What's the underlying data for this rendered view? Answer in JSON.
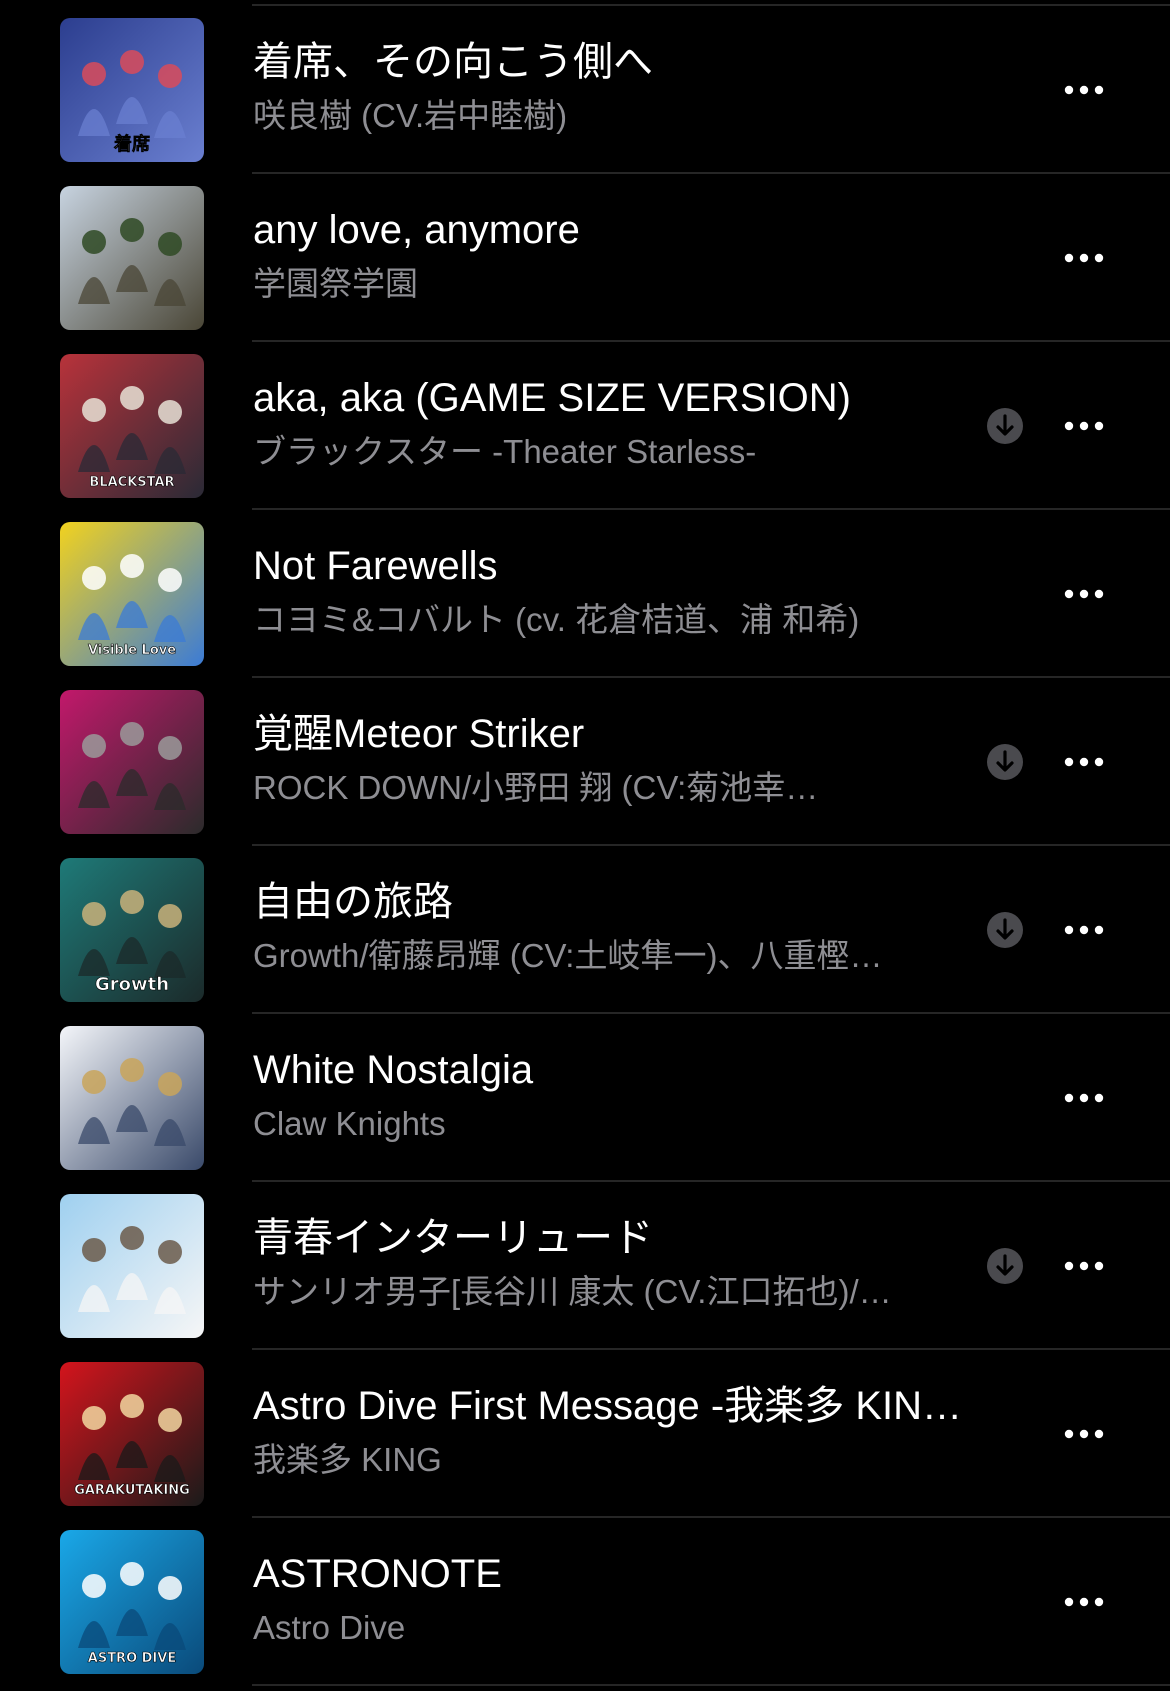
{
  "tracks": [
    {
      "title": "着席、その向こう側へ",
      "artist": "咲良樹 (CV.岩中睦樹)",
      "downloadable": false,
      "artwork": {
        "bg": "#2c3e8f",
        "bg2": "#6a7fd0",
        "accent": "#d94b5a",
        "text": "着席"
      }
    },
    {
      "title": "any love, anymore",
      "artist": "学園祭学園",
      "downloadable": false,
      "artwork": {
        "bg": "#c7d3e0",
        "bg2": "#4a4636",
        "accent": "#2f4a24",
        "text": ""
      }
    },
    {
      "title": "aka, aka (GAME SIZE VERSION)",
      "artist": "ブラックスター -Theater Starless-",
      "downloadable": true,
      "artwork": {
        "bg": "#b8323a",
        "bg2": "#2a2a36",
        "accent": "#e8e2d6",
        "text": "BLACKSTAR"
      }
    },
    {
      "title": "Not Farewells",
      "artist": "コヨミ&コバルト (cv. 花倉桔道、浦 和希)",
      "downloadable": false,
      "artwork": {
        "bg": "#f2d21e",
        "bg2": "#3b7bd6",
        "accent": "#ffffff",
        "text": "Visible Love"
      }
    },
    {
      "title": "覚醒Meteor Striker",
      "artist": "ROCK DOWN/小野田 翔 (CV:菊池幸…",
      "downloadable": true,
      "artwork": {
        "bg": "#c2186b",
        "bg2": "#2b2b2b",
        "accent": "#9a9a9a",
        "text": ""
      }
    },
    {
      "title": "自由の旅路",
      "artist": "Growth/衛藤昂輝 (CV:土岐隼一)、八重樫…",
      "downloadable": true,
      "artwork": {
        "bg": "#1e7a78",
        "bg2": "#1b2a2a",
        "accent": "#c9b27a",
        "text": "Growth"
      }
    },
    {
      "title": "White Nostalgia",
      "artist": "Claw Knights",
      "downloadable": false,
      "artwork": {
        "bg": "#f4f6fa",
        "bg2": "#3a4a6a",
        "accent": "#c9a45a",
        "text": ""
      }
    },
    {
      "title": "青春インターリュード",
      "artist": "サンリオ男子[長谷川 康太 (CV.江口拓也)/…",
      "downloadable": true,
      "artwork": {
        "bg": "#9fd0f0",
        "bg2": "#f6f6f6",
        "accent": "#6b5a4a",
        "text": ""
      }
    },
    {
      "title": "Astro Dive First Message -我楽多 KIN…",
      "artist": "我楽多 KING",
      "downloadable": false,
      "artwork": {
        "bg": "#d4141c",
        "bg2": "#1a1a1a",
        "accent": "#f2d7a0",
        "text": "GARAKUTAKING"
      }
    },
    {
      "title": "ASTRONOTE",
      "artist": "Astro Dive",
      "downloadable": false,
      "artwork": {
        "bg": "#1aa8e8",
        "bg2": "#0a4a7a",
        "accent": "#ffffff",
        "text": "ASTRO DIVE"
      }
    }
  ],
  "icons": {
    "download": "arrow-down-circle-icon",
    "more": "ellipsis-icon"
  },
  "colors": {
    "background": "#000000",
    "title": "#ffffff",
    "subtitle": "#8e8e93",
    "divider": "#262626",
    "download_icon": "#4a4a4e"
  }
}
